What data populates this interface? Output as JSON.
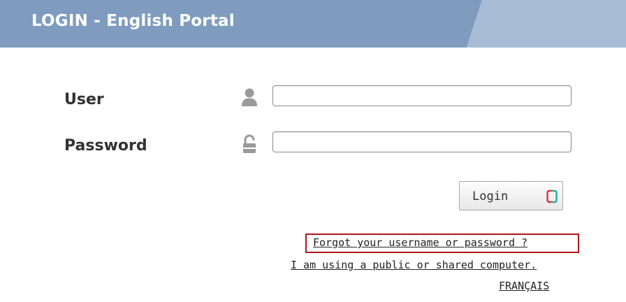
{
  "header": {
    "title": "LOGIN - English Portal"
  },
  "form": {
    "user_label": "User",
    "user_icon": "user-icon",
    "user_value": "",
    "password_label": "Password",
    "password_icon": "lock-icon",
    "password_value": "",
    "login_button_label": "Login",
    "login_button_icon": "refresh-icon"
  },
  "links": {
    "forgot": "Forgot your username or password ?",
    "public_computer": "I am using a public or shared computer.",
    "language": "FRANÇAIS"
  },
  "colors": {
    "header_bar": "#7f9cbf",
    "header_bar_light": "#a8bdd5",
    "highlight_border": "#b1161b",
    "login_icon_teal": "#2aa79b",
    "login_icon_red": "#d9343b"
  }
}
